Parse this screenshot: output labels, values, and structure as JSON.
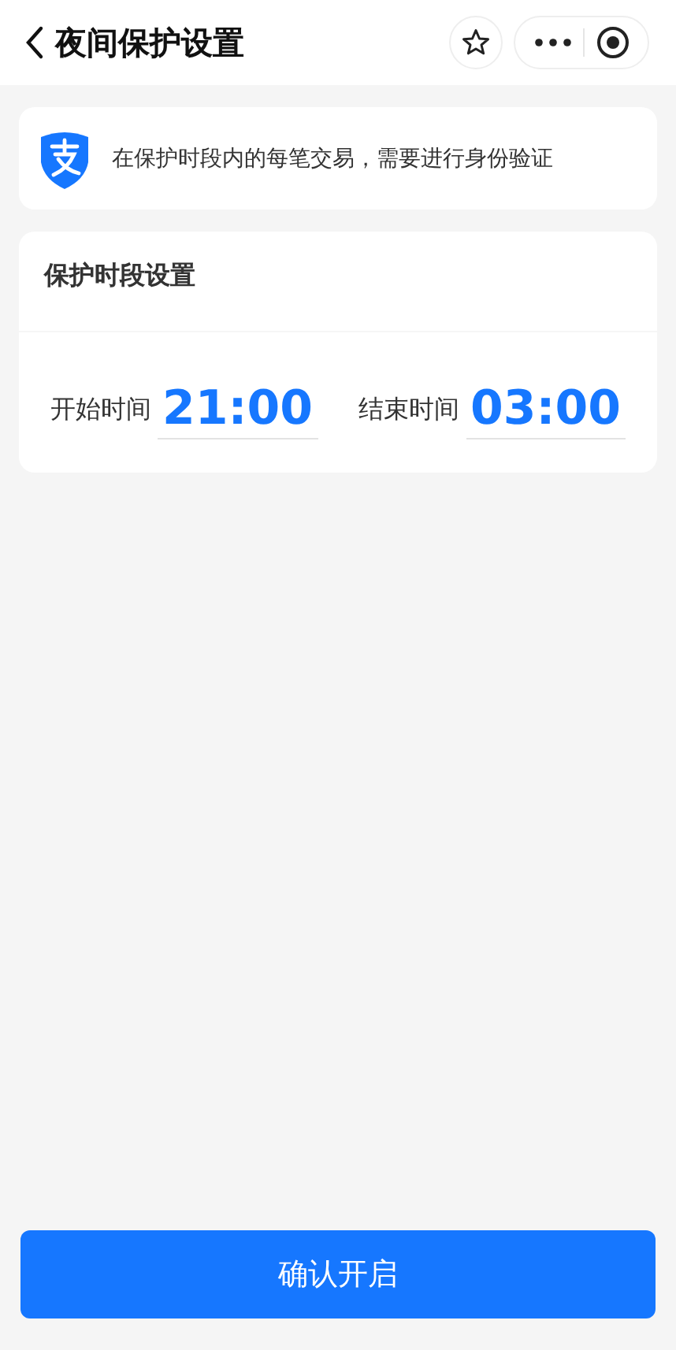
{
  "nav_bar": {
    "title": "夜间保护设置"
  },
  "notice": {
    "text": "在保护时段内的每笔交易，需要进行身份验证"
  },
  "period_card": {
    "title": "保护时段设置",
    "times": [
      {
        "label": "开始时间",
        "value": "21:00"
      },
      {
        "label": "结束时间",
        "value": "03:00"
      }
    ]
  },
  "confirm_button": {
    "label": "确认开启"
  }
}
